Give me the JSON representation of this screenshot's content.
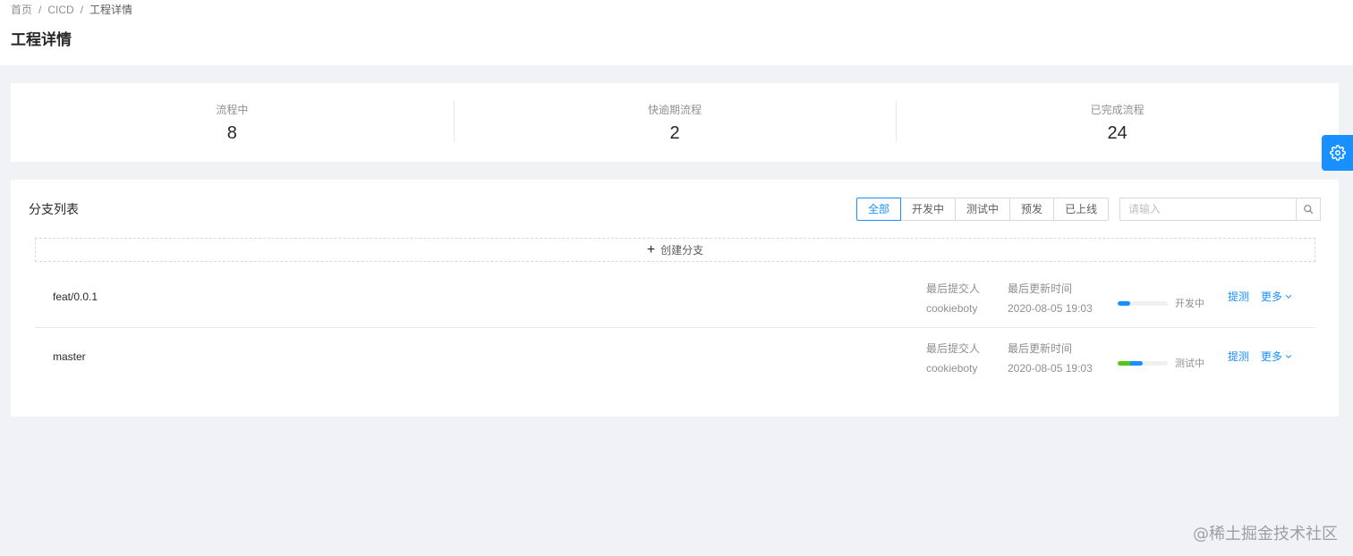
{
  "breadcrumb": {
    "items": [
      "首页",
      "CICD",
      "工程详情"
    ]
  },
  "page": {
    "title": "工程详情"
  },
  "stats": [
    {
      "label": "流程中",
      "value": "8"
    },
    {
      "label": "快逾期流程",
      "value": "2"
    },
    {
      "label": "已完成流程",
      "value": "24"
    }
  ],
  "branches_panel": {
    "title": "分支列表",
    "filters": [
      "全部",
      "开发中",
      "测试中",
      "预发",
      "已上线"
    ],
    "active_filter": "全部",
    "search": {
      "placeholder": "请输入",
      "value": ""
    },
    "create_label": "创建分支",
    "rows": [
      {
        "name": "feat/0.0.1",
        "committer_label": "最后提交人",
        "committer": "cookieboty",
        "time_label": "最后更新时间",
        "time": "2020-08-05 19:03",
        "status": "开发中",
        "progress": 0.25,
        "action": "提测",
        "more": "更多"
      },
      {
        "name": "master",
        "committer_label": "最后提交人",
        "committer": "cookieboty",
        "time_label": "最后更新时间",
        "time": "2020-08-05 19:03",
        "status": "测试中",
        "progress": 0.5,
        "action": "提测",
        "more": "更多"
      }
    ]
  },
  "icons": {
    "settings": "gear-icon",
    "search": "search-icon",
    "create": "plus-icon",
    "more": "chevron-down-icon"
  },
  "colors": {
    "primary": "#1890ff",
    "success": "#52c41a",
    "background": "#f0f2f5"
  },
  "watermark": "@稀土掘金技术社区"
}
